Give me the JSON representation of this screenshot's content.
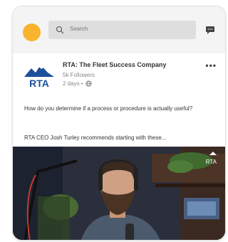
{
  "search": {
    "placeholder": "Search"
  },
  "post": {
    "company": "RTA: The Fleet Success Company",
    "followers": "5k Followers",
    "time": "2 days •",
    "logo_text": "RTA",
    "body_line1": "How do you determine if a process or procedure is actually useful?",
    "body_line2": "RTA CEO Josh Turley recommends starting with these...",
    "media_watermark": "RTA"
  },
  "colors": {
    "avatar": "#f7b42c",
    "brand_blue": "#1c4f9c"
  },
  "icons": [
    "search-icon",
    "chat-icon",
    "more-icon",
    "globe-icon"
  ]
}
